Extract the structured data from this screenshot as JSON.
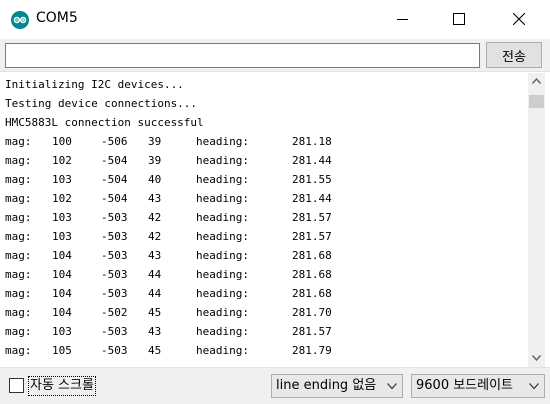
{
  "window": {
    "title": "COM5"
  },
  "toolbar": {
    "input_value": "",
    "send_label": "전송"
  },
  "console": {
    "lines": [
      "Initializing I2C devices...",
      "Testing device connections...",
      "HMC5883L connection successful"
    ],
    "rows": [
      [
        "mag:",
        "100",
        "-506",
        "39",
        "heading:",
        "281.18"
      ],
      [
        "mag:",
        "102",
        "-504",
        "39",
        "heading:",
        "281.44"
      ],
      [
        "mag:",
        "103",
        "-504",
        "40",
        "heading:",
        "281.55"
      ],
      [
        "mag:",
        "102",
        "-504",
        "43",
        "heading:",
        "281.44"
      ],
      [
        "mag:",
        "103",
        "-503",
        "42",
        "heading:",
        "281.57"
      ],
      [
        "mag:",
        "103",
        "-503",
        "42",
        "heading:",
        "281.57"
      ],
      [
        "mag:",
        "104",
        "-503",
        "43",
        "heading:",
        "281.68"
      ],
      [
        "mag:",
        "104",
        "-503",
        "44",
        "heading:",
        "281.68"
      ],
      [
        "mag:",
        "104",
        "-503",
        "44",
        "heading:",
        "281.68"
      ],
      [
        "mag:",
        "104",
        "-502",
        "45",
        "heading:",
        "281.70"
      ],
      [
        "mag:",
        "103",
        "-503",
        "43",
        "heading:",
        "281.57"
      ],
      [
        "mag:",
        "105",
        "-503",
        "45",
        "heading:",
        "281.79"
      ]
    ]
  },
  "status": {
    "autoscroll_label": "자동 스크롤",
    "autoscroll_checked": false,
    "line_ending": "line ending 없음",
    "baud_rate": "9600 보드레이트"
  },
  "colors": {
    "app_icon": "#00878f",
    "button_face": "#e1e1e1",
    "chrome": "#f0f0f0"
  }
}
